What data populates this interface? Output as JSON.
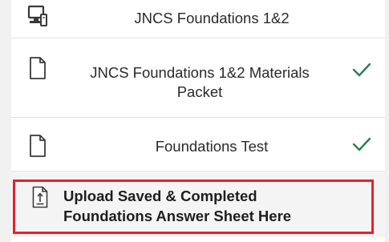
{
  "items": [
    {
      "icon": "desktop-computer-icon",
      "title": "JNCS Foundations 1&2",
      "completed": false
    },
    {
      "icon": "document-icon",
      "title_lines": [
        "JNCS Foundations 1&2 Materials",
        "Packet"
      ],
      "completed": true
    },
    {
      "icon": "document-icon",
      "title": "Foundations Test",
      "completed": true
    }
  ],
  "upload": {
    "icon": "upload-file-icon",
    "lines": [
      "Upload Saved & Completed",
      "Foundations Answer Sheet Here"
    ]
  },
  "colors": {
    "check": "#2e7d4f",
    "highlight": "#e8202a"
  }
}
